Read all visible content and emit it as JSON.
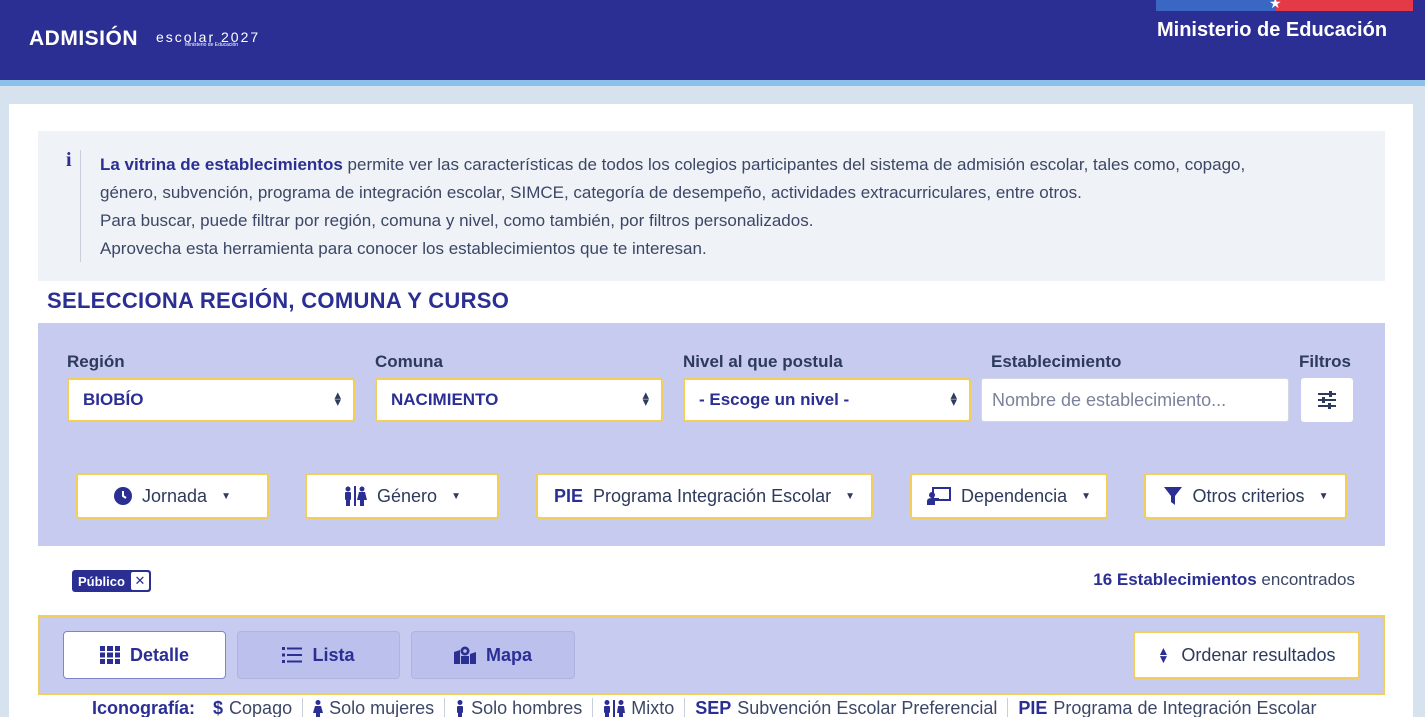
{
  "header": {
    "logo_main": "ADMISIÓN",
    "logo_sub": "escolar 2027",
    "logo_tiny": "Ministerio de Educación",
    "ministry": "Ministerio de Educación"
  },
  "info": {
    "bold_lead": "La vitrina de establecimientos",
    "line1_rest": " permite ver las características de todos los colegios participantes del sistema de admisión escolar, tales como, copago,",
    "line2": "género, subvención, programa de integración escolar, SIMCE, categoría de desempeño, actividades extracurriculares, entre otros.",
    "line3": "Para buscar, puede filtrar por región, comuna y nivel, como también, por filtros personalizados.",
    "line4": "Aprovecha esta herramienta para conocer los establecimientos que te interesan."
  },
  "section_title": "SELECCIONA REGIÓN, COMUNA Y CURSO",
  "filters": {
    "region_label": "Región",
    "region_value": "BIOBÍO",
    "comuna_label": "Comuna",
    "comuna_value": "NACIMIENTO",
    "nivel_label": "Nivel al que postula",
    "nivel_value": "- Escoge un nivel -",
    "establecimiento_label": "Establecimiento",
    "establecimiento_placeholder": "Nombre de establecimiento...",
    "filtros_label": "Filtros"
  },
  "chips": {
    "jornada": "Jornada",
    "genero": "Género",
    "pie_abbr": "PIE",
    "pie": "Programa Integración Escolar",
    "dependencia": "Dependencia",
    "otros": "Otros criterios"
  },
  "active_tag": "Público",
  "results": {
    "count": "16 Establecimientos",
    "suffix": " encontrados"
  },
  "views": {
    "detalle": "Detalle",
    "lista": "Lista",
    "mapa": "Mapa",
    "ordenar": "Ordenar resultados"
  },
  "legend": {
    "title": "Iconografía:",
    "copago_sym": "$",
    "copago": "Copago",
    "mujeres": "Solo mujeres",
    "hombres": "Solo hombres",
    "mixto": "Mixto",
    "sep_abbr": "SEP",
    "sep": "Subvención Escolar Preferencial",
    "pie_abbr": "PIE",
    "pie": "Programa de Integración Escolar"
  },
  "colors": {
    "brand": "#2b2f93",
    "panel": "#c8cbf0",
    "accent_border": "#f3cf5a"
  }
}
